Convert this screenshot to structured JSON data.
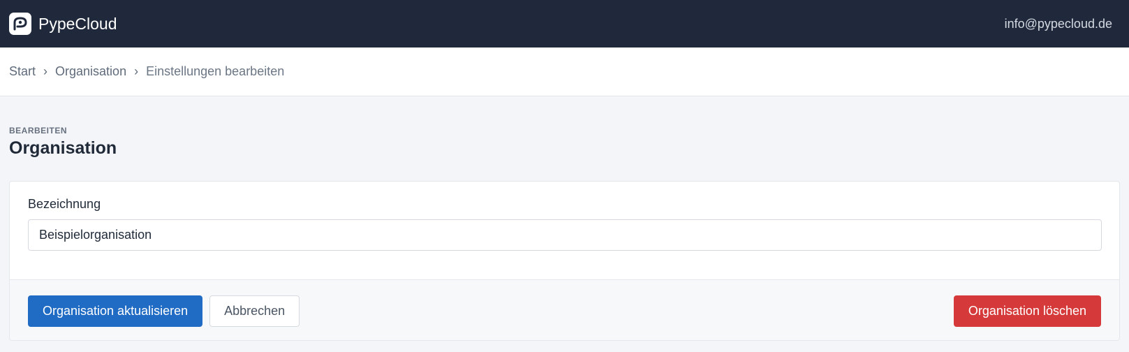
{
  "navbar": {
    "brand_name": "PypeCloud",
    "brand_icon": "cloud-logo-icon",
    "user_email": "info@pypecloud.de"
  },
  "breadcrumb": {
    "items": [
      "Start",
      "Organisation",
      "Einstellungen bearbeiten"
    ],
    "separator": "›"
  },
  "page_header": {
    "pretitle": "BEARBEITEN",
    "title": "Organisation"
  },
  "form": {
    "name_label": "Bezeichnung",
    "name_value": "Beispielorganisation"
  },
  "actions": {
    "update_label": "Organisation aktualisieren",
    "cancel_label": "Abbrechen",
    "delete_label": "Organisation löschen"
  },
  "colors": {
    "navbar": "#1f293b",
    "primary": "#206bc4",
    "danger": "#d63939"
  }
}
